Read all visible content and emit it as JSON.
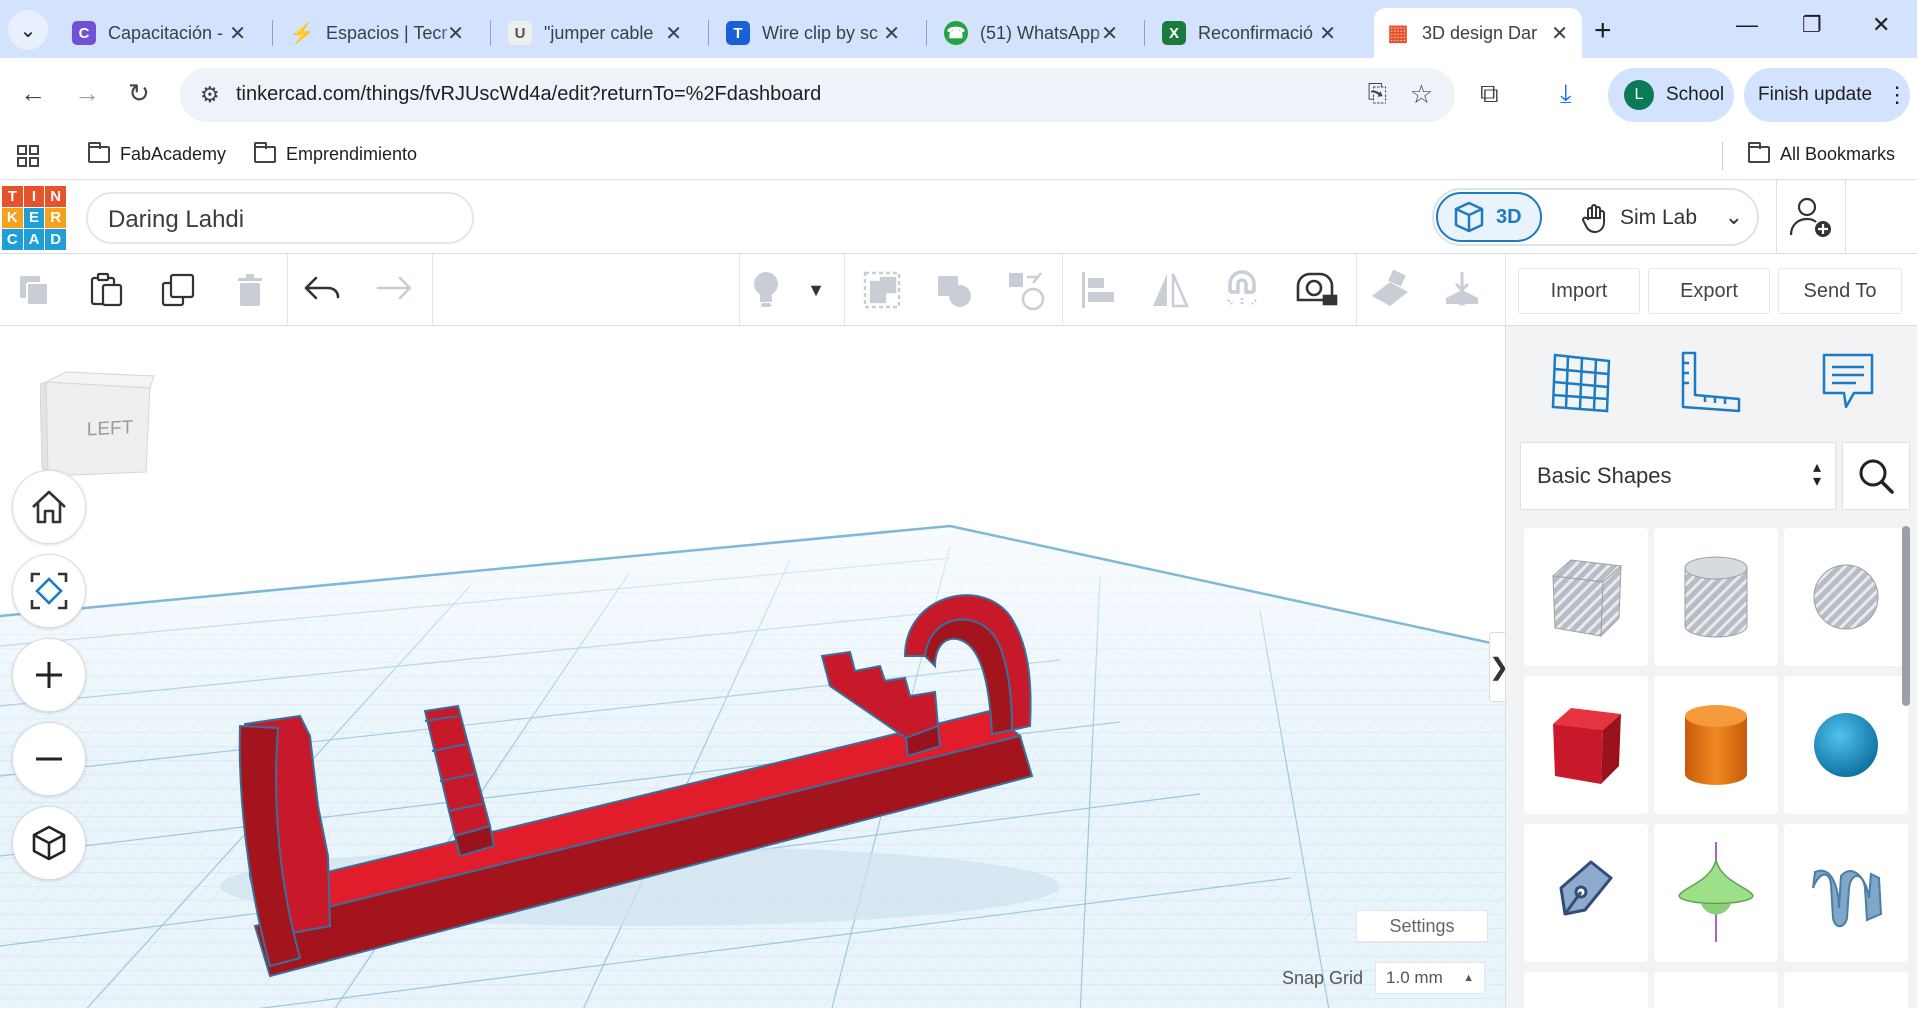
{
  "browser": {
    "tabs": [
      {
        "title": "Capacitación -",
        "favicon_color": "#6f52d6",
        "favicon_glyph": "C"
      },
      {
        "title": "Espacios | Tecr",
        "favicon_color": "#3b5bdb",
        "favicon_glyph": "⚡"
      },
      {
        "title": "\"jumper cable",
        "favicon_color": "#777777",
        "favicon_glyph": "U"
      },
      {
        "title": "Wire clip by sc",
        "favicon_color": "#1a5fd6",
        "favicon_glyph": "T"
      },
      {
        "title": "(51) WhatsApp",
        "favicon_color": "#25a244",
        "favicon_glyph": "☎"
      },
      {
        "title": "Reconfirmació",
        "favicon_color": "#1d7a3e",
        "favicon_glyph": "X"
      },
      {
        "title": "3D design Dar",
        "favicon_color": "#e8522b",
        "favicon_glyph": "▦",
        "active": true
      }
    ],
    "new_tab_label": "+",
    "url": "tinkercad.com/things/fvRJUscWd4a/edit?returnTo=%2Fdashboard",
    "profile_initial": "L",
    "profile_name": "School",
    "finish_update_label": "Finish update",
    "bookmarks": [
      "FabAcademy",
      "Emprendimiento"
    ],
    "all_bookmarks_label": "All Bookmarks"
  },
  "tinkercad": {
    "logo_letters": [
      "T",
      "I",
      "N",
      "K",
      "E",
      "R",
      "C",
      "A",
      "D"
    ],
    "logo_colors": [
      "#e8522b",
      "#e8522b",
      "#e8522b",
      "#f4a11c",
      "#1e9fd8",
      "#f4a11c",
      "#1e9fd8",
      "#1e9fd8",
      "#1e9fd8"
    ],
    "design_name": "Daring Lahdi",
    "mode_3d_label": "3D",
    "sim_lab_label": "Sim Lab",
    "toolbar": {
      "import_label": "Import",
      "export_label": "Export",
      "send_to_label": "Send To"
    },
    "viewcube_label": "LEFT",
    "settings_label": "Settings",
    "snap_grid_label": "Snap Grid",
    "snap_grid_value": "1.0 mm",
    "shapes_category": "Basic Shapes",
    "accent_color": "#1e7bc1",
    "model_color": "#d91f2b"
  }
}
